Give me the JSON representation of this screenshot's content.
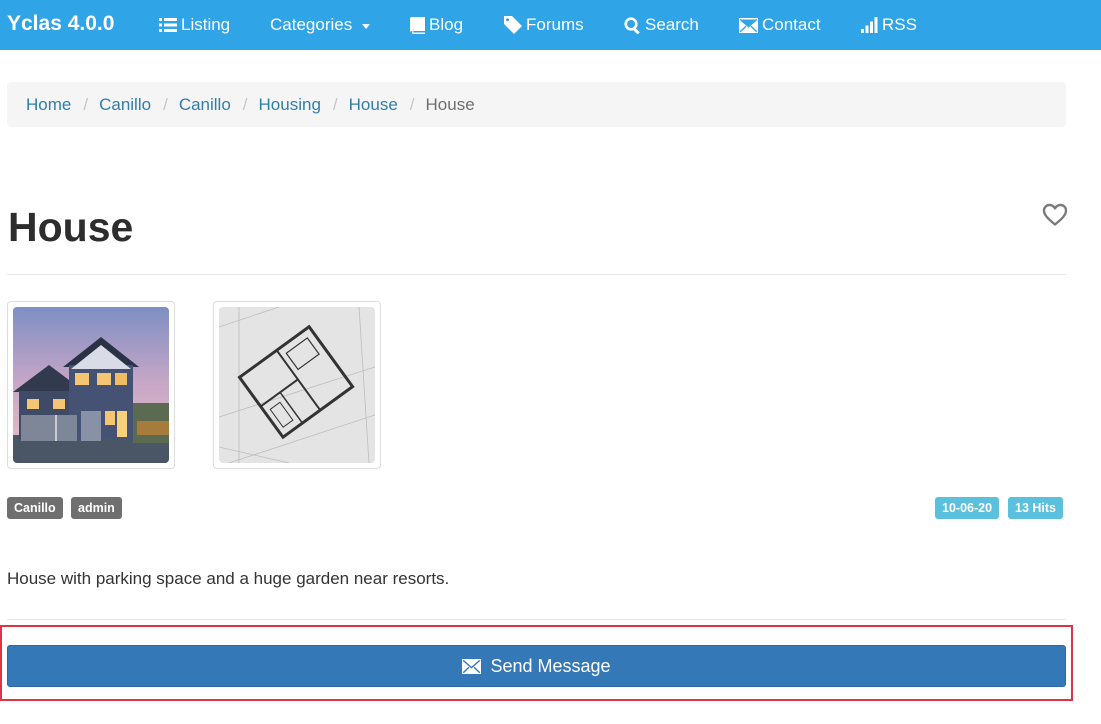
{
  "navbar": {
    "brand": "Yclas 4.0.0",
    "items": [
      {
        "label": "Listing",
        "icon": "list-icon"
      },
      {
        "label": "Categories",
        "icon": "chevron-down-icon"
      },
      {
        "label": "Blog",
        "icon": "book-icon"
      },
      {
        "label": "Forums",
        "icon": "tag-icon"
      },
      {
        "label": "Search",
        "icon": "search-icon"
      },
      {
        "label": "Contact",
        "icon": "envelope-icon"
      },
      {
        "label": "RSS",
        "icon": "signal-icon"
      }
    ],
    "color": "#2fa4e7"
  },
  "breadcrumb": {
    "items": [
      "Home",
      "Canillo",
      "Canillo",
      "Housing",
      "House"
    ],
    "active": "House",
    "separator": "/"
  },
  "ad": {
    "title": "House",
    "favorite_icon": "heart-icon",
    "images": [
      {
        "alt": "house-photo"
      },
      {
        "alt": "floor-plan"
      }
    ],
    "tags_left": [
      "Canillo",
      "admin"
    ],
    "tags_right": [
      "10-06-20",
      "13 Hits"
    ],
    "description": "House with parking space and a huge garden near resorts.",
    "send_button": "Send Message",
    "send_icon": "envelope-icon"
  },
  "colors": {
    "link": "#317eac",
    "button": "#3478b7",
    "label_grey": "#6f6f6f",
    "label_info": "#5bc0de",
    "highlight": "#dc3545"
  }
}
